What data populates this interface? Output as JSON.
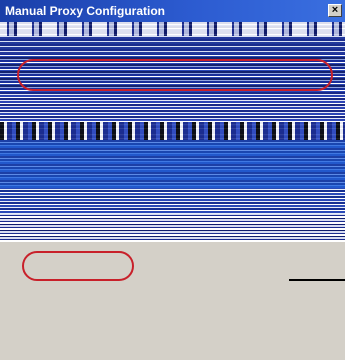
{
  "window": {
    "title": "Manual Proxy Configuration",
    "close_label": "×"
  },
  "colors": {
    "titlebar": "#2c5bd0",
    "annotation": "#c8202a",
    "panel": "#d4d0c8"
  },
  "icons": {
    "close": "close-icon"
  }
}
